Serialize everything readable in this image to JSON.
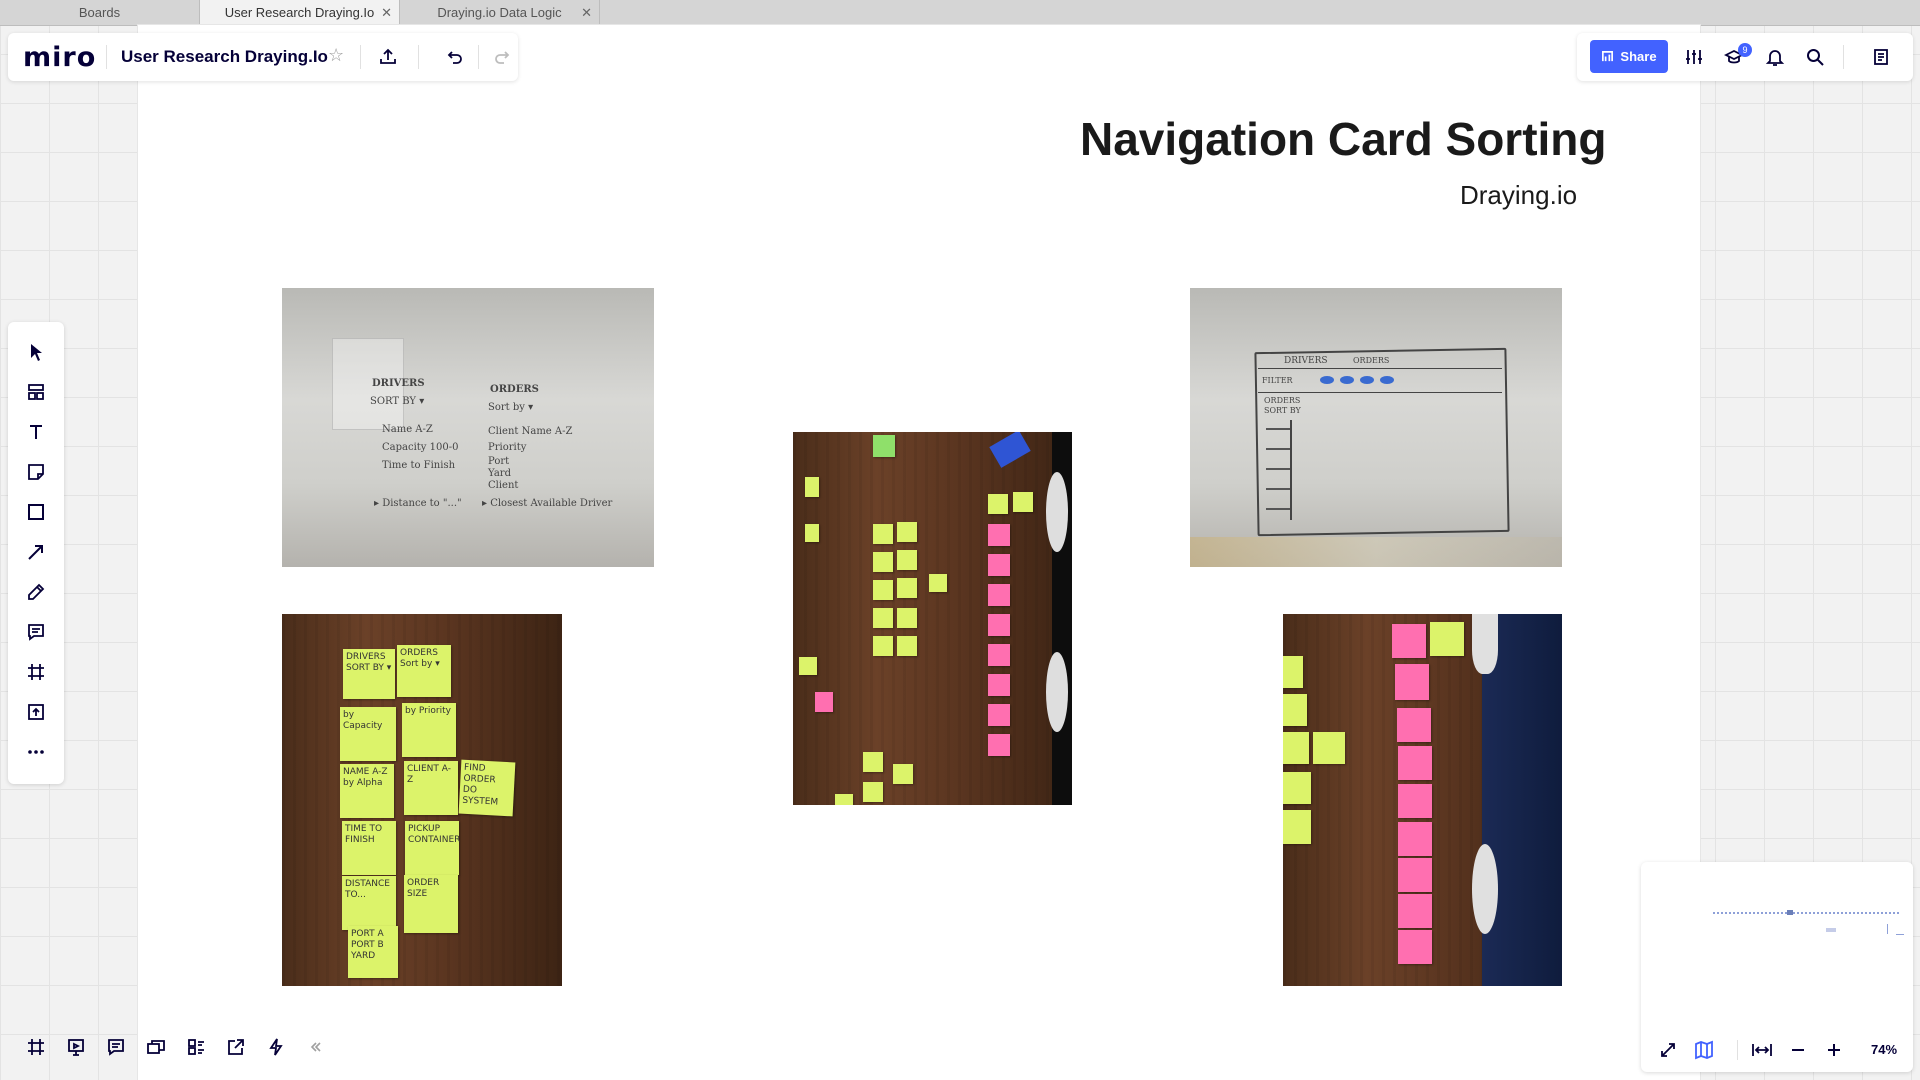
{
  "browser": {
    "tabs": [
      {
        "label": "Boards"
      },
      {
        "label": "User Research Draying.Io",
        "close": "✕"
      },
      {
        "label": "Draying.io Data Logic",
        "close": "✕"
      }
    ]
  },
  "header": {
    "logo": "miro",
    "board_title": "User Research Draying.Io",
    "share_label": "Share",
    "notification_count": "9"
  },
  "frame": {
    "title": "Navigation Card Sorting",
    "subtitle": "Draying.io"
  },
  "whiteboard_left": {
    "col1": [
      "DRIVERS",
      "SORT BY ▾",
      "Name A-Z",
      "Capacity 100-0",
      "Time to Finish",
      "▸ Distance to \"...\""
    ],
    "col2": [
      "ORDERS",
      "Sort by ▾",
      "Client Name A-Z",
      "Priority",
      "Port",
      "Yard",
      "Client",
      "▸ Closest Available Driver"
    ]
  },
  "whiteboard_right": {
    "labels": [
      "DRIVERS",
      "ORDERS",
      "FILTER",
      "ORDERS",
      "SORT BY"
    ]
  },
  "sticky_notes_left": {
    "notes": [
      "DRIVERS SORT BY ▾",
      "ORDERS Sort by ▾",
      "by Capacity",
      "by Priority",
      "NAME A-Z by Alpha",
      "CLIENT A-Z",
      "FIND ORDER DO SYSTEM",
      "TIME TO FINISH",
      "PICKUP CONTAINER",
      "DISTANCE TO...",
      "ORDER SIZE",
      "PORT A PORT B YARD"
    ]
  },
  "zoom": {
    "level": "74%"
  },
  "colors": {
    "accent": "#4262ff",
    "sticky_yellow": "#dcf36a",
    "sticky_pink": "#ff6fb0",
    "brand_text": "#050038"
  }
}
